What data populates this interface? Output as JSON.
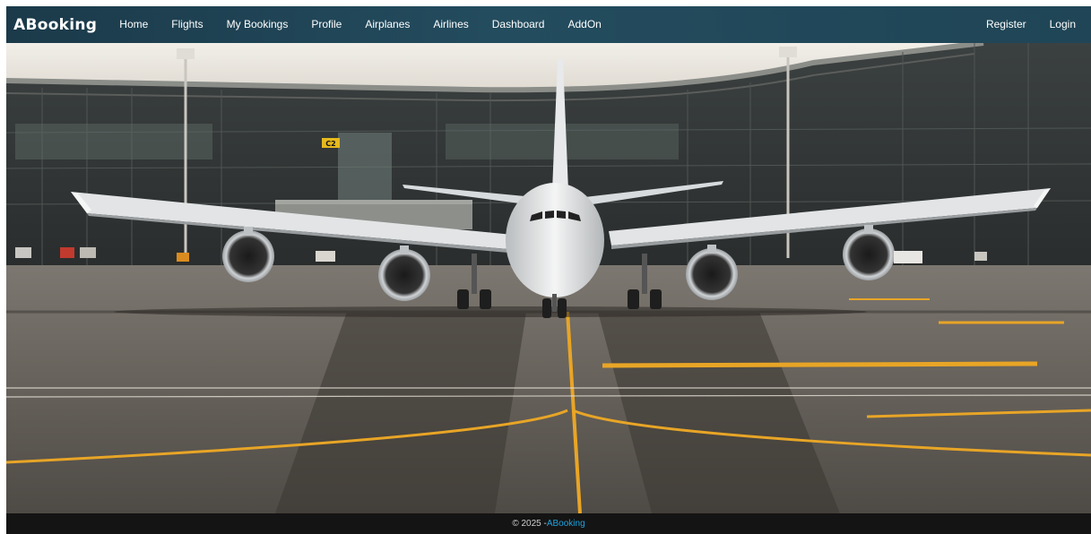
{
  "navbar": {
    "brand": "ABooking",
    "links": [
      {
        "label": "Home"
      },
      {
        "label": "Flights"
      },
      {
        "label": "My Bookings"
      },
      {
        "label": "Profile"
      },
      {
        "label": "Airplanes"
      },
      {
        "label": "Airlines"
      },
      {
        "label": "Dashboard"
      },
      {
        "label": "AddOn"
      }
    ],
    "register_label": "Register",
    "login_label": "Login"
  },
  "hero": {
    "gate_sign": "C2"
  },
  "footer": {
    "copyright": "© 2025 - ",
    "brand_link": "ABooking"
  },
  "colors": {
    "navbar_bg": "#1f4556",
    "footer_bg": "#141414",
    "footer_link": "#1da3e0",
    "taxi_line": "#e8a526"
  }
}
